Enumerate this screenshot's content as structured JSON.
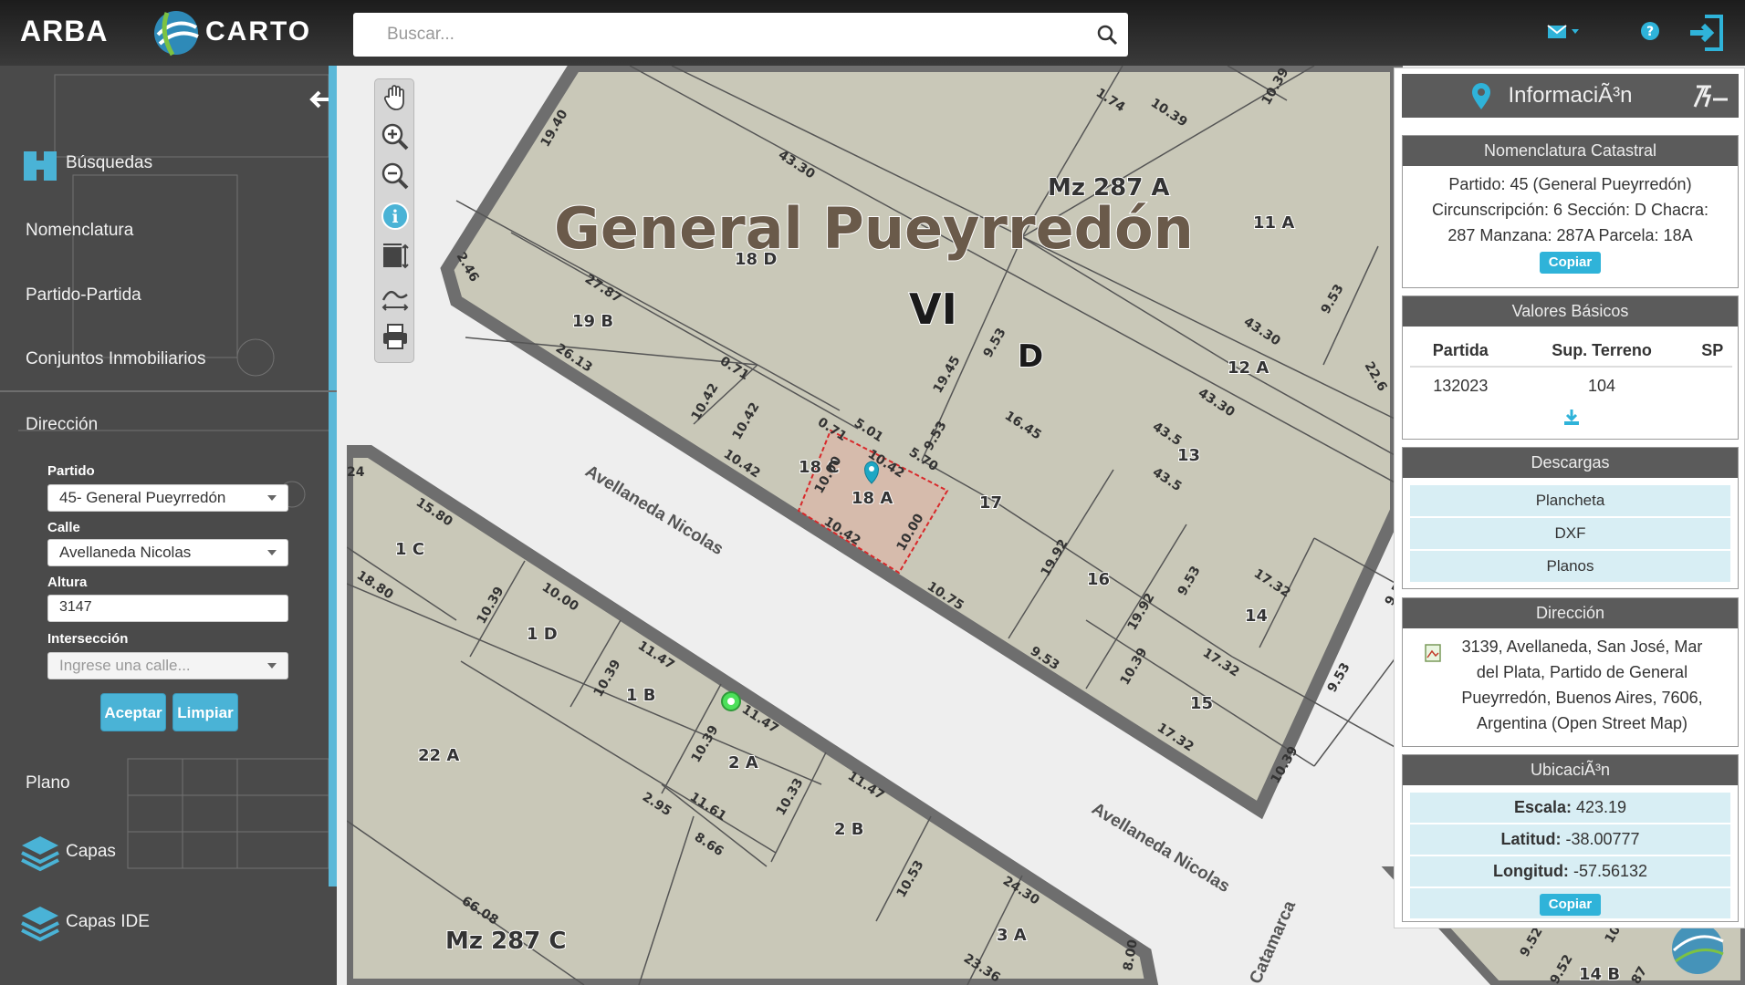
{
  "header": {
    "brand": "ARBA",
    "logo_text": "CARTO",
    "search_placeholder": "Buscar..."
  },
  "sidebar": {
    "items": [
      {
        "label": "Búsquedas"
      },
      {
        "label": "Nomenclatura"
      },
      {
        "label": "Partido-Partida"
      },
      {
        "label": "Conjuntos Inmobiliarios"
      },
      {
        "label": "Dirección"
      },
      {
        "label": "Plano"
      },
      {
        "label": "Capas"
      },
      {
        "label": "Capas IDE"
      }
    ],
    "form": {
      "partido_label": "Partido",
      "partido_value": "45- General Pueyrredón",
      "calle_label": "Calle",
      "calle_value": "Avellaneda Nicolas",
      "altura_label": "Altura",
      "altura_value": "3147",
      "interseccion_label": "Intersección",
      "interseccion_placeholder": "Ingrese una calle...",
      "accept_label": "Aceptar",
      "clear_label": "Limpiar"
    }
  },
  "map": {
    "title": "General Pueyrredón",
    "circ": "VI",
    "section": "D",
    "blocks": [
      "Mz 287 A",
      "Mz 287 C"
    ],
    "streets": [
      "Avellaneda Nicolas",
      "Avellaneda Nicolas",
      "Catamarca"
    ],
    "parcels": [
      "18 D",
      "19 B",
      "18 C",
      "18 A",
      "17",
      "16",
      "15",
      "14",
      "13",
      "12 A",
      "11 A",
      "1 C",
      "1 D",
      "1 B",
      "2 A",
      "2 B",
      "22 A",
      "3 A",
      "14 B"
    ],
    "measures": [
      "19.40",
      "43.30",
      "1.74",
      "10.39",
      "10.39",
      "2.46",
      "27.87",
      "26.13",
      "0.71",
      "10.42",
      "10.42",
      "10.42",
      "0.71",
      "5.01",
      "10.42",
      "5.70",
      "9.53",
      "19.45",
      "9.53",
      "16.45",
      "43.5",
      "43.5",
      "43.30",
      "43.30",
      "22.6",
      "9.53",
      "10.00",
      "10.42",
      "10.00",
      "10.75",
      "19.92",
      "9.53",
      "19.92",
      "10.39",
      "9.53",
      "17.32",
      "17.32",
      "17.32",
      "9.53",
      "10.39",
      "9.53",
      "24",
      "15.80",
      "18.80",
      "10.39",
      "10.00",
      "11.47",
      "10.39",
      "11.47",
      "10.39",
      "11.61",
      "2.95",
      "8.66",
      "10.33",
      "11.47",
      "10.53",
      "24.30",
      "66.08",
      "23.36",
      "8.00",
      "9.52",
      "10",
      "9.52",
      "87"
    ]
  },
  "info": {
    "title": "InformaciÃ³n",
    "nomenclatura": {
      "title": "Nomenclatura Catastral",
      "lines": [
        "Partido: 45 (General Pueyrredón)",
        "Circunscripción: 6 Sección: D Chacra:",
        "287 Manzana: 287A Parcela: 18A"
      ],
      "copy": "Copiar"
    },
    "valores": {
      "title": "Valores Básicos",
      "headers": [
        "Partida",
        "Sup. Terreno",
        "SP"
      ],
      "row": [
        "132023",
        "104",
        ""
      ]
    },
    "descargas": {
      "title": "Descargas",
      "items": [
        "Plancheta",
        "DXF",
        "Planos"
      ]
    },
    "direccion": {
      "title": "Dirección",
      "lines": [
        "3139, Avellaneda, San José, Mar",
        "del Plata, Partido de General",
        "Pueyrredón, Buenos Aires, 7606,",
        "Argentina (Open Street Map)"
      ]
    },
    "ubicacion": {
      "title": "UbicaciÃ³n",
      "escala_label": "Escala:",
      "escala": "423.19",
      "latitud_label": "Latitud:",
      "latitud": "-38.00777",
      "longitud_label": "Longitud:",
      "longitud": "-57.56132",
      "copy": "Copiar"
    }
  },
  "colors": {
    "accent": "#4ab3d6",
    "parcel_fill": "#c9c8b8",
    "selected_outline": "#d8282a"
  }
}
